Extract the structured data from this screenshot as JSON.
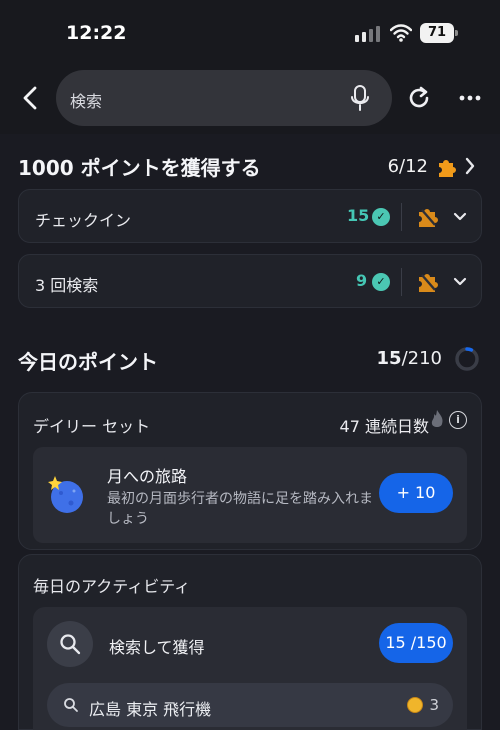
{
  "status": {
    "time": "12:22",
    "battery": "71"
  },
  "toolbar": {
    "search_label": "検索"
  },
  "challenge": {
    "title": "1000 ポイントを獲得する",
    "progress": "6/12",
    "items": [
      {
        "label": "チェックイン",
        "count": "15"
      },
      {
        "label": "3 回検索",
        "count": "9"
      }
    ]
  },
  "today": {
    "title": "今日のポイント",
    "earned": "15",
    "total": "/210",
    "progress_fraction": 0.071
  },
  "daily_set": {
    "label": "デイリー セット",
    "streak": "47 連続日数",
    "journey": {
      "title": "月への旅路",
      "description": "最初の月面歩行者の物語に足を踏み入れましょう",
      "bonus": "+ 10"
    }
  },
  "activity": {
    "label": "毎日のアクティビティ",
    "search_earn": "検索して獲得",
    "score": "15 /150",
    "query": "広島 東京 飛行機",
    "coin_value": "3"
  },
  "colors": {
    "background": "#1a1b22",
    "card": "#202229",
    "accent_blue": "#1565e8",
    "check_teal": "#4bc7b3",
    "puzzle_orange": "#f0a020"
  }
}
